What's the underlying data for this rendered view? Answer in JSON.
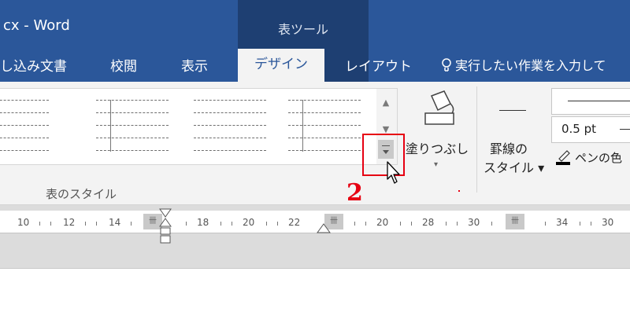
{
  "window": {
    "title": "cx - Word",
    "tools_label": "表ツール"
  },
  "tabs": [
    {
      "label": "し込み文書",
      "active": false
    },
    {
      "label": "校閲",
      "active": false
    },
    {
      "label": "表示",
      "active": false
    },
    {
      "label": "デザイン",
      "active": true
    },
    {
      "label": "レイアウト",
      "active": false
    }
  ],
  "tell_me": {
    "text": "実行したい作業を入力して",
    "icon": "lightbulb-icon"
  },
  "ribbon": {
    "table_styles_group_label": "表のスタイル",
    "gallery_scroll_up": "▲",
    "gallery_scroll_down": "▼",
    "shading_label": "塗りつぶし",
    "shading_arrow": "▾",
    "border_style_label_line1": "罫線の",
    "border_style_label_line2": "スタイル",
    "border_style_arrow": "▾",
    "pen_weight_value": "0.5 pt",
    "pen_color_label": "ペンの色"
  },
  "annotation": {
    "step_number": "2",
    "highlight_color": "#e60012"
  },
  "ruler": {
    "numbers": [
      "10",
      "12",
      "14",
      "18",
      "20",
      "22",
      "20",
      "28",
      "30",
      "34",
      "30"
    ],
    "marker_glyph": "卌"
  },
  "colors": {
    "title_bar": "#2b579a",
    "tools_band": "#1e3f72",
    "ribbon_bg": "#f3f3f3",
    "accent_red": "#e60012"
  }
}
